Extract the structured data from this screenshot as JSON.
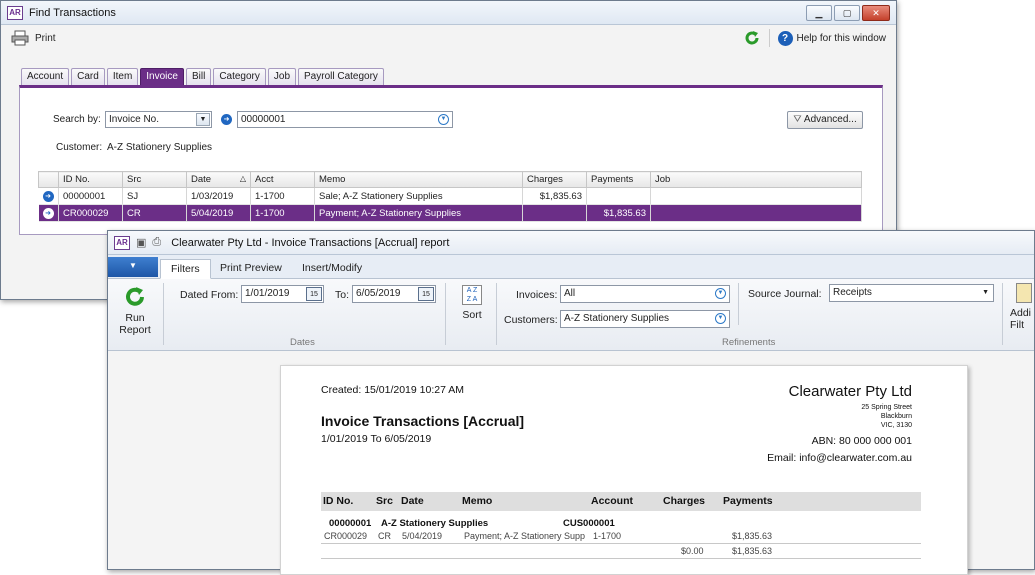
{
  "find": {
    "title": "Find Transactions",
    "print": "Print",
    "help": "Help for this window",
    "tabs": [
      "Account",
      "Card",
      "Item",
      "Invoice",
      "Bill",
      "Category",
      "Job",
      "Payroll Category"
    ],
    "search_by_label": "Search by:",
    "search_by_value": "Invoice No.",
    "search_value": "00000001",
    "advanced": "Advanced...",
    "customer_label": "Customer:",
    "customer_value": "A-Z Stationery Supplies",
    "columns": [
      "ID No.",
      "Src",
      "Date",
      "Acct",
      "Memo",
      "Charges",
      "Payments",
      "Job"
    ],
    "rows": [
      {
        "id": "00000001",
        "src": "SJ",
        "date": "1/03/2019",
        "acct": "1-1700",
        "memo": "Sale; A-Z Stationery Supplies",
        "charges": "$1,835.63",
        "payments": "",
        "job": ""
      },
      {
        "id": "CR000029",
        "src": "CR",
        "date": "5/04/2019",
        "acct": "1-1700",
        "memo": "Payment; A-Z Stationery Supplies",
        "charges": "",
        "payments": "$1,835.63",
        "job": ""
      }
    ]
  },
  "report": {
    "title": "Clearwater Pty Ltd - Invoice Transactions [Accrual] report",
    "tabs": [
      "Filters",
      "Print Preview",
      "Insert/Modify"
    ],
    "run_report": [
      "Run",
      "Report"
    ],
    "dated_from_label": "Dated From:",
    "dated_from": "1/01/2019",
    "to_label": "To:",
    "to": "6/05/2019",
    "calendar_day": "15",
    "dates_group": "Dates",
    "sort": "Sort",
    "invoices_label": "Invoices:",
    "invoices": "All",
    "customers_label": "Customers:",
    "customers": "A-Z Stationery Supplies",
    "source_journal_label": "Source Journal:",
    "source_journal": "Receipts",
    "refinements_group": "Refinements",
    "add_filters": [
      "Addi",
      "Filt"
    ],
    "doc": {
      "created": "Created: 15/01/2019 10:27 AM",
      "heading": "Invoice Transactions [Accrual]",
      "range": "1/01/2019 To 6/05/2019",
      "company": "Clearwater Pty Ltd",
      "addr1": "25 Spring Street",
      "addr2": "Blackburn",
      "addr3": "VIC, 3130",
      "abn": "ABN: 80 000 000 001",
      "email": "Email: info@clearwater.com.au",
      "cols": [
        "ID No.",
        "Src",
        "Date",
        "Memo",
        "Account",
        "Charges",
        "Payments"
      ],
      "group_id": "00000001",
      "group_name": "A-Z Stationery Supplies",
      "group_acct": "CUS000001",
      "line": {
        "id": "CR000029",
        "src": "CR",
        "date": "5/04/2019",
        "memo": "Payment; A-Z Stationery Supp",
        "acct": "1-1700",
        "payments": "$1,835.63"
      },
      "total_charges": "$0.00",
      "total_payments": "$1,835.63"
    }
  }
}
